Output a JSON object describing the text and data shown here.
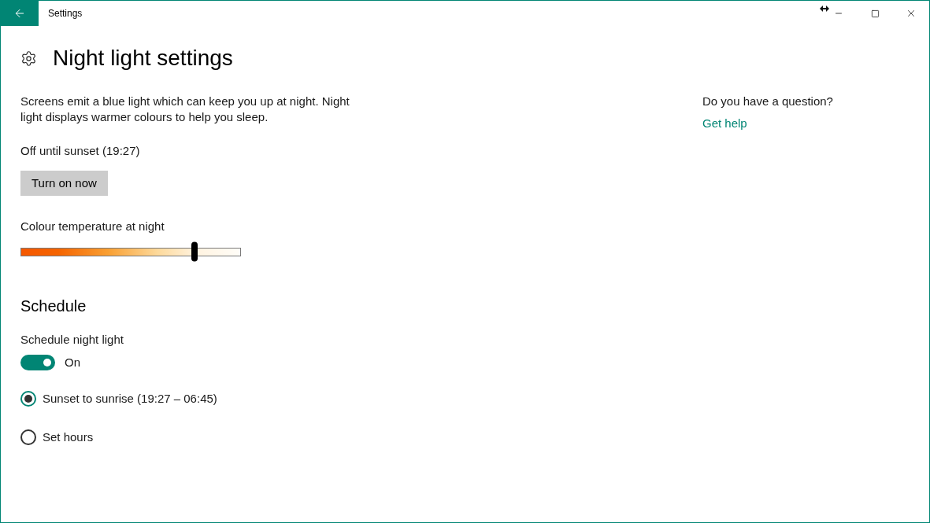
{
  "window": {
    "title": "Settings"
  },
  "page": {
    "title": "Night light settings"
  },
  "description": "Screens emit a blue light which can keep you up at night. Night light displays warmer colours to help you sleep.",
  "status": "Off until sunset (19:27)",
  "turn_on_button": "Turn on now",
  "colour_temperature": {
    "label": "Colour temperature at night",
    "level": 0.8
  },
  "schedule": {
    "heading": "Schedule",
    "toggle": {
      "label": "Schedule night light",
      "on": true,
      "state_text": "On"
    },
    "options": [
      {
        "label": "Sunset to sunrise (19:27 – 06:45)",
        "selected": true
      },
      {
        "label": "Set hours",
        "selected": false
      }
    ]
  },
  "help": {
    "question": "Do you have a question?",
    "link": "Get help"
  }
}
